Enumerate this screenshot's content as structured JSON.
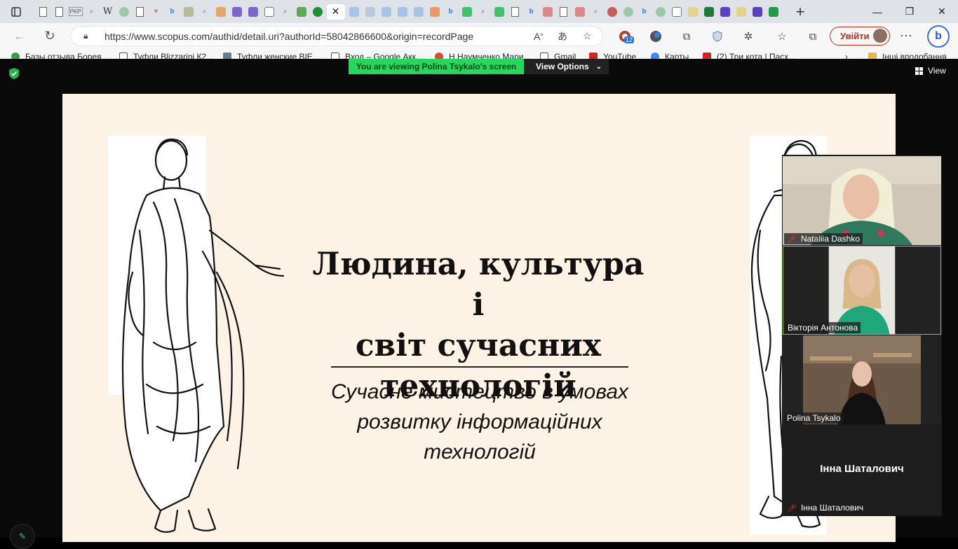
{
  "browser": {
    "url": "https://www.scopus.com/authid/detail.uri?authorId=58042866600&origin=recordPage",
    "signin_label": "Увійти",
    "extension_badge": "12",
    "bookmarks": [
      "Базы отзыва Борея",
      "Туфли Blizzarini К2...",
      "Туфли женские BIE...",
      "Вход – Google Акк...",
      "Н Наумченко Мари...",
      "Gmail",
      "YouTube",
      "Карты",
      "(2) Три кота | Пасх...",
      "Інші вподобання"
    ]
  },
  "zoom": {
    "viewing_banner": "You are viewing Polina Tsykalo's screen",
    "view_options_label": "View Options",
    "view_label": "View"
  },
  "slide": {
    "title_lines": [
      "Людина, культура і",
      "світ сучасних",
      "технологій"
    ],
    "subtitle_lines": [
      "Сучасне мистецтво в умовах",
      "розвитку інформаційних",
      "технологій"
    ]
  },
  "participants": [
    {
      "name": "Nataliia Dashko",
      "muted": true
    },
    {
      "name": "Вікторія Антонова",
      "muted": false,
      "speaking": true
    },
    {
      "name": "Polina Tsykalo",
      "muted": false
    },
    {
      "name": "Інна Шаталович",
      "muted": true,
      "display_name": "Інна Шаталович"
    }
  ]
}
